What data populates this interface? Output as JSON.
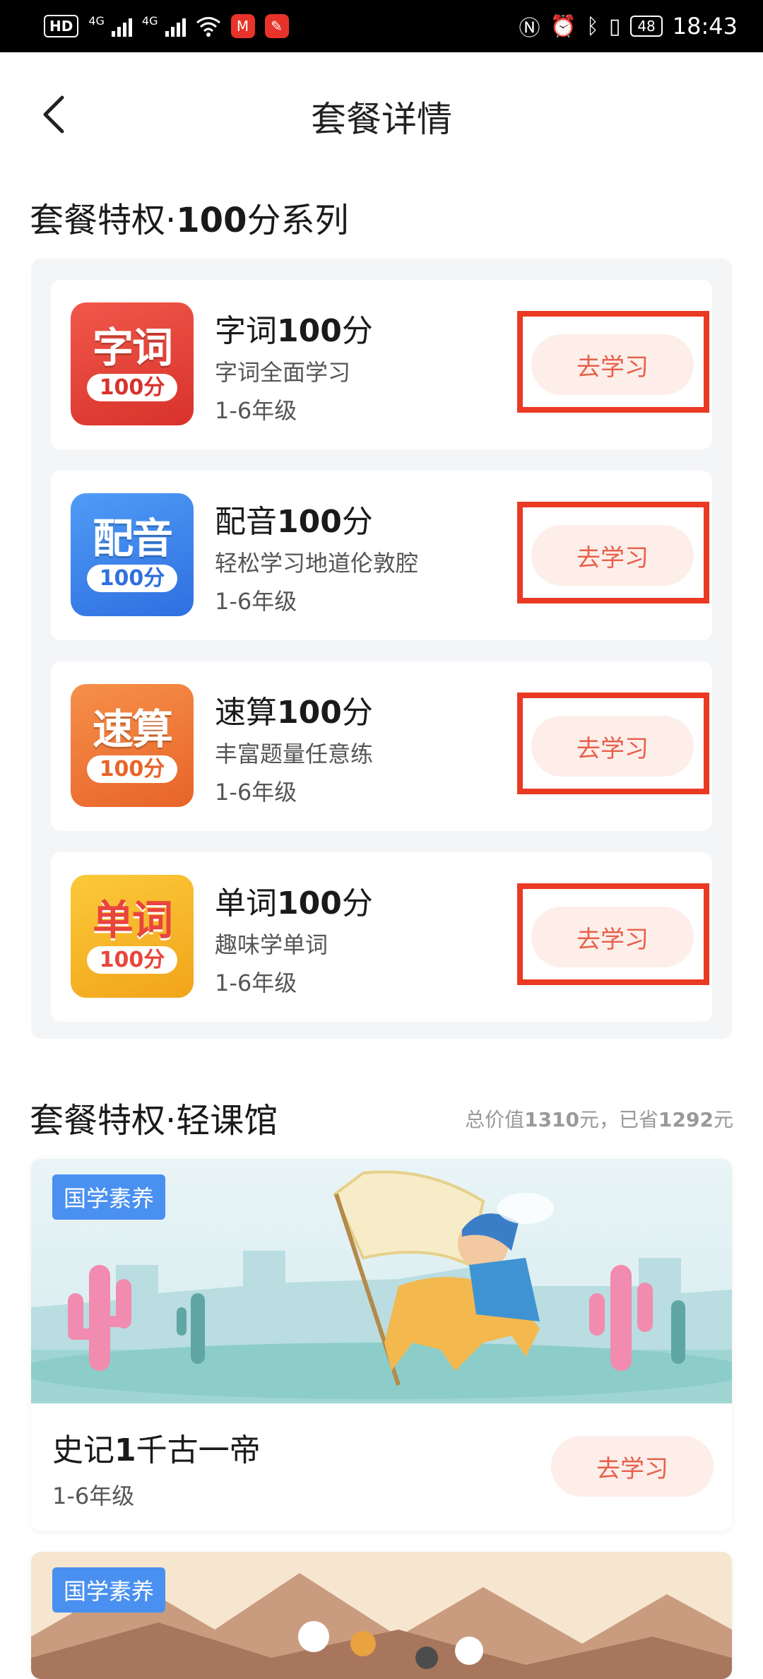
{
  "status_bar": {
    "left_chip": "HD",
    "net_1": "4G",
    "net_2": "4G",
    "battery": "48",
    "time": "18:43"
  },
  "nav": {
    "title": "套餐详情",
    "back_icon": "chevron-left-icon"
  },
  "section1": {
    "title_prefix": "套餐特权·",
    "title_bold": "100",
    "title_suffix": "分系列"
  },
  "courses": [
    {
      "name_prefix": "字词",
      "name_bold": "100",
      "name_suffix": "分",
      "desc": "字词全面学习",
      "grade": "1-6年级",
      "logo_text": "字词",
      "logo_badge": "100分",
      "button": "去学习",
      "logo_color": "#e8453c"
    },
    {
      "name_prefix": "配音",
      "name_bold": "100",
      "name_suffix": "分",
      "desc": "轻松学习地道伦敦腔",
      "grade": "1-6年级",
      "logo_text": "配音",
      "logo_badge": "100分",
      "button": "去学习",
      "logo_color": "#3d86f0"
    },
    {
      "name_prefix": "速算",
      "name_bold": "100",
      "name_suffix": "分",
      "desc": "丰富题量任意练",
      "grade": "1-6年级",
      "logo_text": "速算",
      "logo_badge": "100分",
      "button": "去学习",
      "logo_color": "#f07b35"
    },
    {
      "name_prefix": "单词",
      "name_bold": "100",
      "name_suffix": "分",
      "desc": "趣味学单词",
      "grade": "1-6年级",
      "logo_text": "单词",
      "logo_badge": "100分",
      "button": "去学习",
      "logo_color": "#f5b21f"
    }
  ],
  "section2": {
    "title": "套餐特权·轻课馆",
    "note_prefix": "总价值",
    "note_total": "1310",
    "note_mid": "元，已省",
    "note_saved": "1292",
    "note_suffix": "元"
  },
  "banners": [
    {
      "tag": "国学素养",
      "name_prefix": "史记",
      "name_bold": "1",
      "name_suffix": "千古一帝",
      "grade": "1-6年级",
      "button": "去学习"
    },
    {
      "tag": "国学素养"
    }
  ],
  "colors": {
    "accent": "#e8604a",
    "highlight": "#ea3a24",
    "tag": "#4a90f0"
  }
}
